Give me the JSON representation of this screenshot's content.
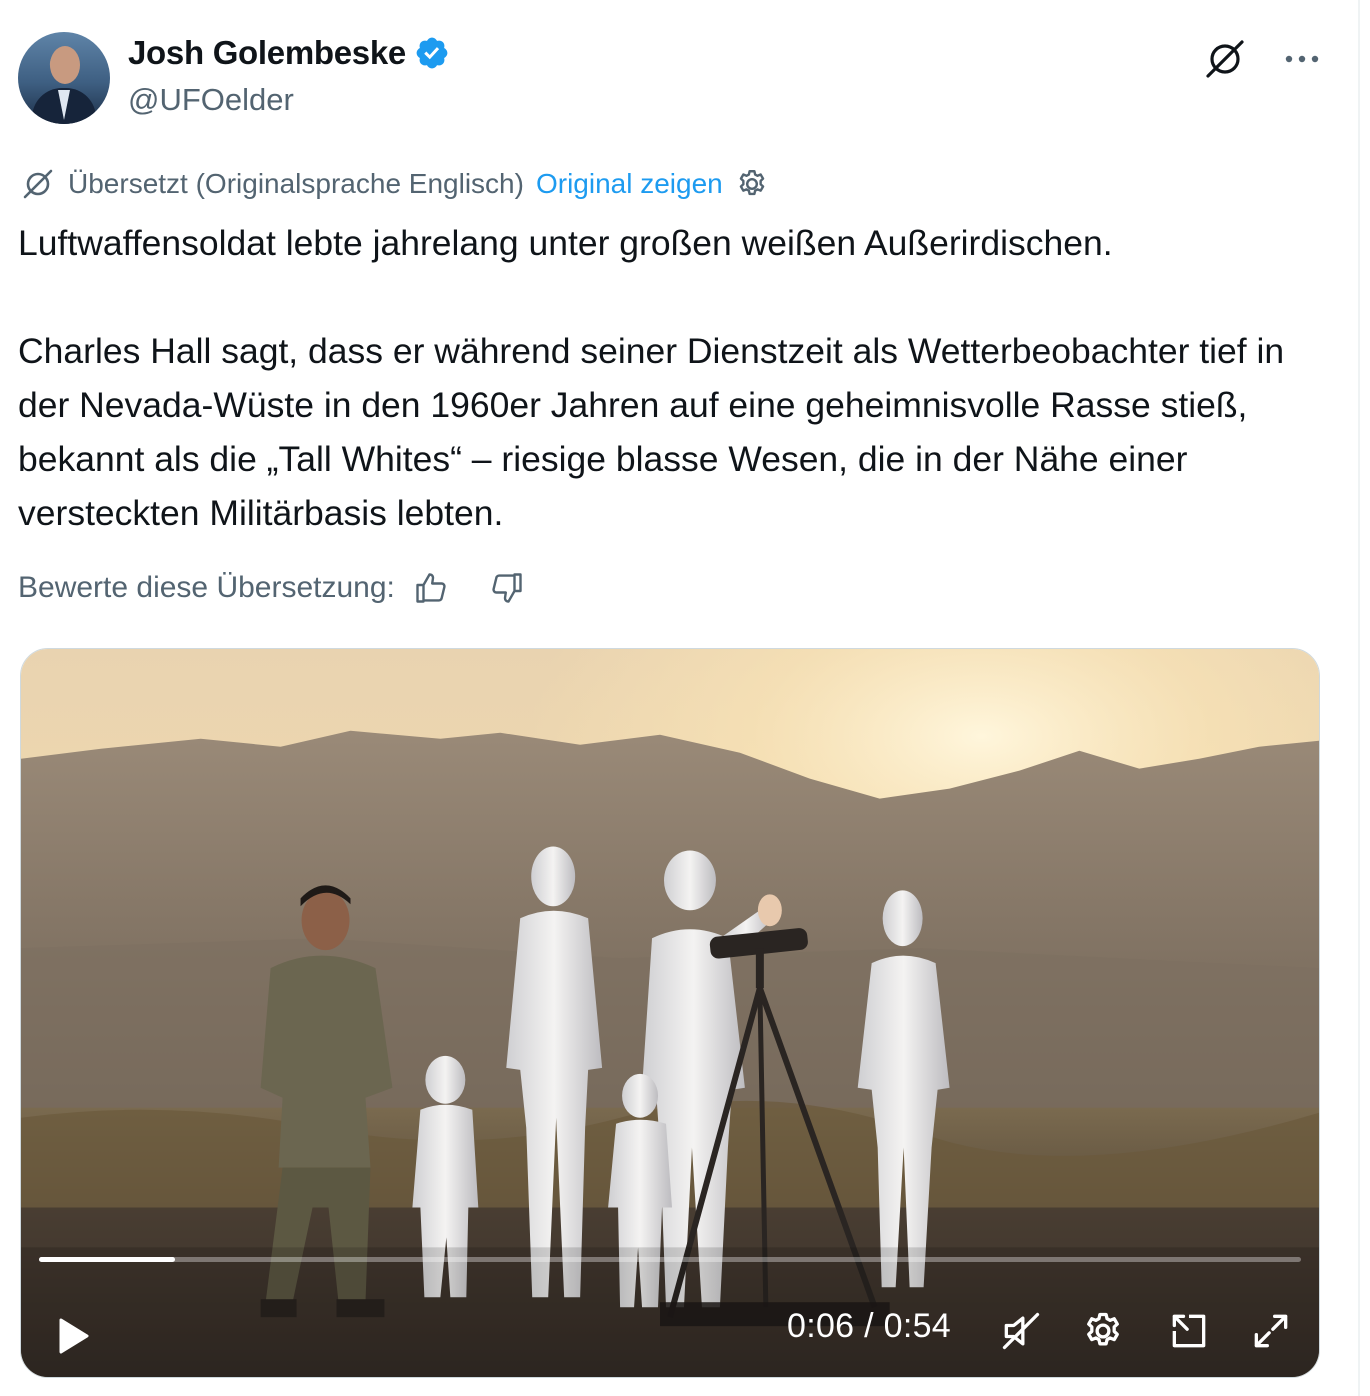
{
  "author": {
    "display_name": "Josh Golembeske",
    "handle": "@UFOelder",
    "verified": true
  },
  "translation": {
    "status": "Übersetzt (Originalsprache Englisch)",
    "show_original": "Original zeigen"
  },
  "tweet": {
    "line1": "Luftwaffensoldat lebte jahrelang unter großen weißen Außerirdischen.",
    "paragraph2": "Charles Hall sagt, dass er während seiner Dienstzeit als Wetterbeobachter tief in der Nevada-Wüste in den 1960er Jahren auf eine geheimnisvolle Rasse stieß, bekannt als die „Tall Whites“ – riesige blasse Wesen, die in der Nähe einer versteckten Militärbasis lebten."
  },
  "rating": {
    "label": "Bewerte diese Übersetzung:"
  },
  "video": {
    "current_time": "0:06",
    "duration": "0:54",
    "time_display": "0:06 / 0:54",
    "progress_fraction": 0.108,
    "muted": true
  },
  "colors": {
    "accent": "#1d9bf0",
    "secondary_text": "#536471"
  }
}
